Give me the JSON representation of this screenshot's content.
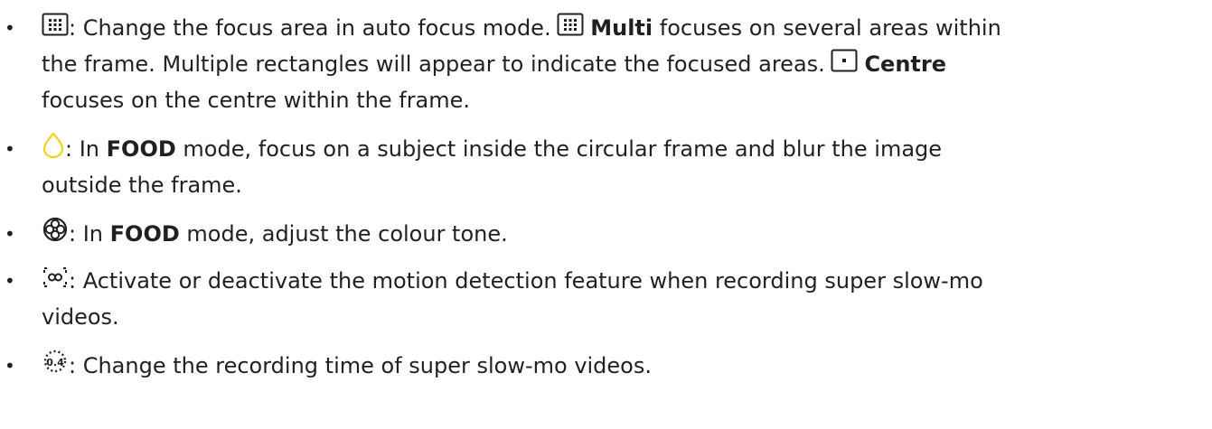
{
  "items": [
    {
      "icon": "multi-focus-grid-icon",
      "line1_pre": ": Change the focus area in auto focus mode.",
      "multi_label": "Multi",
      "line1_post": "focuses on several areas within",
      "line2_pre": "the frame. Multiple rectangles will appear to indicate the focused areas.",
      "centre_label": "Centre",
      "line3": "focuses on the centre within the frame."
    },
    {
      "icon": "circular-frame-icon",
      "icon_color": "#f2d21b",
      "line1_pre": ": In",
      "food_label": "FOOD",
      "line1_post": "mode, focus on a subject inside the circular frame and blur the image",
      "line2": "outside the frame."
    },
    {
      "icon": "colour-tone-icon",
      "line1_pre": ": In",
      "food_label": "FOOD",
      "line1_post": "mode, adjust the colour tone."
    },
    {
      "icon": "motion-detection-icon",
      "line1": ": Activate or deactivate the motion detection feature when recording super slow-mo",
      "line2": "videos."
    },
    {
      "icon": "recording-time-icon",
      "icon_text": "0.4",
      "line1": ": Change the recording time of super slow-mo videos."
    }
  ],
  "bullet_char": "•"
}
